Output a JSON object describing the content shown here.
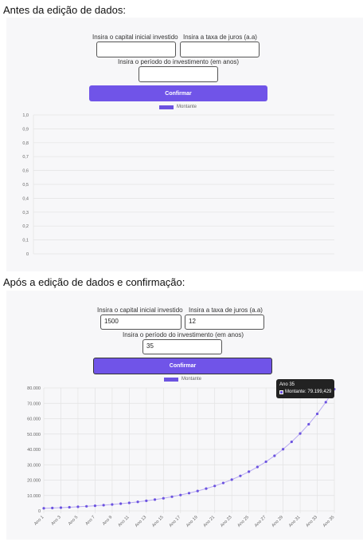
{
  "before": {
    "caption": "Antes da edição de dados:",
    "form": {
      "capital_label": "Insira o capital inicial investido",
      "rate_label": "Insira a taxa de juros (a.a)",
      "period_label": "Insira o período do investimento (em anos)",
      "capital_value": "",
      "rate_value": "",
      "period_value": "",
      "confirm_label": "Confirmar"
    },
    "legend": "Montante",
    "y_ticks": [
      "1,0",
      "0,9",
      "0,8",
      "0,7",
      "0,6",
      "0,5",
      "0,4",
      "0,3",
      "0,2",
      "0,1",
      "0"
    ]
  },
  "after": {
    "caption": "Após a edição de dados e confirmação:",
    "form": {
      "capital_label": "Insira o capital inicial investido",
      "rate_label": "Insira a taxa de juros (a.a)",
      "period_label": "Insira o período do investimento (em anos)",
      "capital_value": "1500",
      "rate_value": "12",
      "period_value": "35",
      "confirm_label": "Confirmar"
    },
    "legend": "Montante",
    "tooltip": {
      "title": "Ano 35",
      "text": "Montante: 79.199,429"
    }
  },
  "colors": {
    "accent": "#7054e8",
    "series": "#6c53e0",
    "grid": "#e3e3e3"
  },
  "chart_data": [
    {
      "type": "line",
      "series": [
        {
          "name": "Montante",
          "values": []
        }
      ],
      "y_ticks": [
        "1,0",
        "0,9",
        "0,8",
        "0,7",
        "0,6",
        "0,5",
        "0,4",
        "0,3",
        "0,2",
        "0,1",
        "0"
      ],
      "ylim": [
        0,
        1
      ]
    },
    {
      "type": "line",
      "x": [
        "Ano 1",
        "Ano 2",
        "Ano 3",
        "Ano 4",
        "Ano 5",
        "Ano 6",
        "Ano 7",
        "Ano 8",
        "Ano 9",
        "Ano 10",
        "Ano 11",
        "Ano 12",
        "Ano 13",
        "Ano 14",
        "Ano 15",
        "Ano 16",
        "Ano 17",
        "Ano 18",
        "Ano 19",
        "Ano 20",
        "Ano 21",
        "Ano 22",
        "Ano 23",
        "Ano 24",
        "Ano 25",
        "Ano 26",
        "Ano 27",
        "Ano 28",
        "Ano 29",
        "Ano 30",
        "Ano 31",
        "Ano 32",
        "Ano 33",
        "Ano 34",
        "Ano 35"
      ],
      "x_tick_labels": [
        "Ano 1",
        "Ano 3",
        "Ano 5",
        "Ano 7",
        "Ano 9",
        "Ano 11",
        "Ano 13",
        "Ano 15",
        "Ano 17",
        "Ano 19",
        "Ano 21",
        "Ano 23",
        "Ano 25",
        "Ano 27",
        "Ano 29",
        "Ano 31",
        "Ano 33",
        "Ano 35"
      ],
      "series": [
        {
          "name": "Montante",
          "values": [
            1680,
            1882,
            2107,
            2360,
            2644,
            2961,
            3316,
            3714,
            4160,
            4659,
            5218,
            5845,
            6546,
            7332,
            8211,
            9197,
            10300,
            11536,
            12921,
            14471,
            16208,
            18153,
            20331,
            22771,
            25504,
            28564,
            31992,
            35831,
            40131,
            44946,
            50340,
            56381,
            63146,
            70724,
            79199
          ]
        }
      ],
      "y_ticks": [
        "80.000",
        "70.000",
        "60.000",
        "50.000",
        "40.000",
        "30.000",
        "20.000",
        "10.000",
        "0"
      ],
      "ylim": [
        0,
        80000
      ]
    }
  ]
}
